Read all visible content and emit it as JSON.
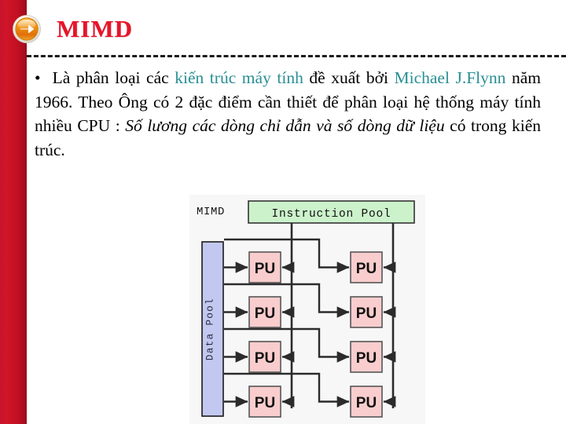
{
  "slide": {
    "title": "MIMD",
    "title_color": "#e8142a",
    "accent_bar_color": "#c41022",
    "arrow_icon": "arrow-right-circle-icon"
  },
  "body": {
    "bullet": "•",
    "segments": [
      {
        "text": "Là phân loại các ",
        "style": "normal"
      },
      {
        "text": "kiến trúc máy tính",
        "style": "teal"
      },
      {
        "text": " đề xuất bởi ",
        "style": "normal"
      },
      {
        "text": "Michael J.Flynn",
        "style": "teal"
      },
      {
        "text": " năm 1966. Theo Ông có 2 đặc điểm cần thiết để phân loại hệ thống máy tính nhiều CPU : ",
        "style": "normal"
      },
      {
        "text": "Số lương các dòng chỉ dẫn và số dòng dữ liệu",
        "style": "italic"
      },
      {
        "text": " có trong kiến trúc.",
        "style": "normal"
      }
    ],
    "plain_text": "• Là phân loại các kiến trúc máy tính đề xuất bởi Michael J.Flynn năm 1966. Theo Ông có 2 đặc điểm cần thiết để phân loại hệ thống máy tính nhiều CPU : Số lương các dòng chỉ dẫn và số dòng dữ liệu có trong kiến trúc."
  },
  "diagram": {
    "caption": "MIMD",
    "instruction_pool_label": "Instruction Pool",
    "instruction_pool_color": "#ccf2cc",
    "data_pool_label": "Data Pool",
    "data_pool_color": "#c3c8f0",
    "pu_label": "PU",
    "pu_color": "#f9cdcd",
    "pu_rows": 4,
    "pu_columns": 2,
    "pu_units": [
      {
        "row": 1,
        "col": 1,
        "label": "PU"
      },
      {
        "row": 1,
        "col": 2,
        "label": "PU"
      },
      {
        "row": 2,
        "col": 1,
        "label": "PU"
      },
      {
        "row": 2,
        "col": 2,
        "label": "PU"
      },
      {
        "row": 3,
        "col": 1,
        "label": "PU"
      },
      {
        "row": 3,
        "col": 2,
        "label": "PU"
      },
      {
        "row": 4,
        "col": 1,
        "label": "PU"
      },
      {
        "row": 4,
        "col": 2,
        "label": "PU"
      }
    ]
  }
}
